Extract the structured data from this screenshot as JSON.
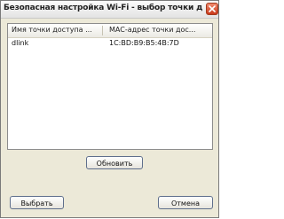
{
  "window": {
    "title": "Безопасная настройка Wi-Fi - выбор точки дос..."
  },
  "list": {
    "columns": [
      "Имя точки доступа ...",
      "MAC-адрес точки дос..."
    ],
    "rows": [
      [
        "dlink",
        "1C:BD:B9:B5:4B:7D"
      ]
    ]
  },
  "buttons": {
    "refresh": "Обновить",
    "select": "Выбрать",
    "cancel": "Отмена"
  },
  "icons": {
    "close": "close-icon"
  }
}
